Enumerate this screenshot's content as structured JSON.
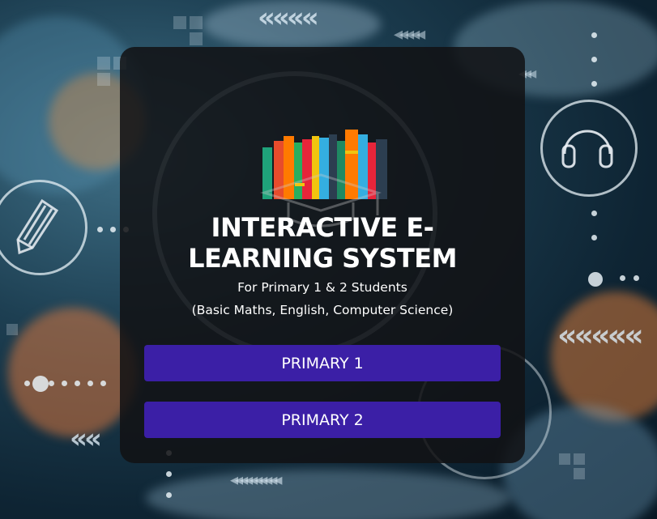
{
  "hero": {
    "title_line1": "INTERACTIVE E-",
    "title_line2": "LEARNING SYSTEM",
    "subtitle_line1": "For Primary 1 & 2 Students",
    "subtitle_line2": "(Basic Maths, English, Computer Science)"
  },
  "buttons": {
    "primary1_label": "PRIMARY 1",
    "primary2_label": "PRIMARY 2"
  },
  "colors": {
    "button": "#3b1fa6",
    "card": "#121214"
  },
  "icons": [
    "bookshelf-icon",
    "pencil-icon",
    "headphones-icon",
    "graduation-cap-icon"
  ]
}
